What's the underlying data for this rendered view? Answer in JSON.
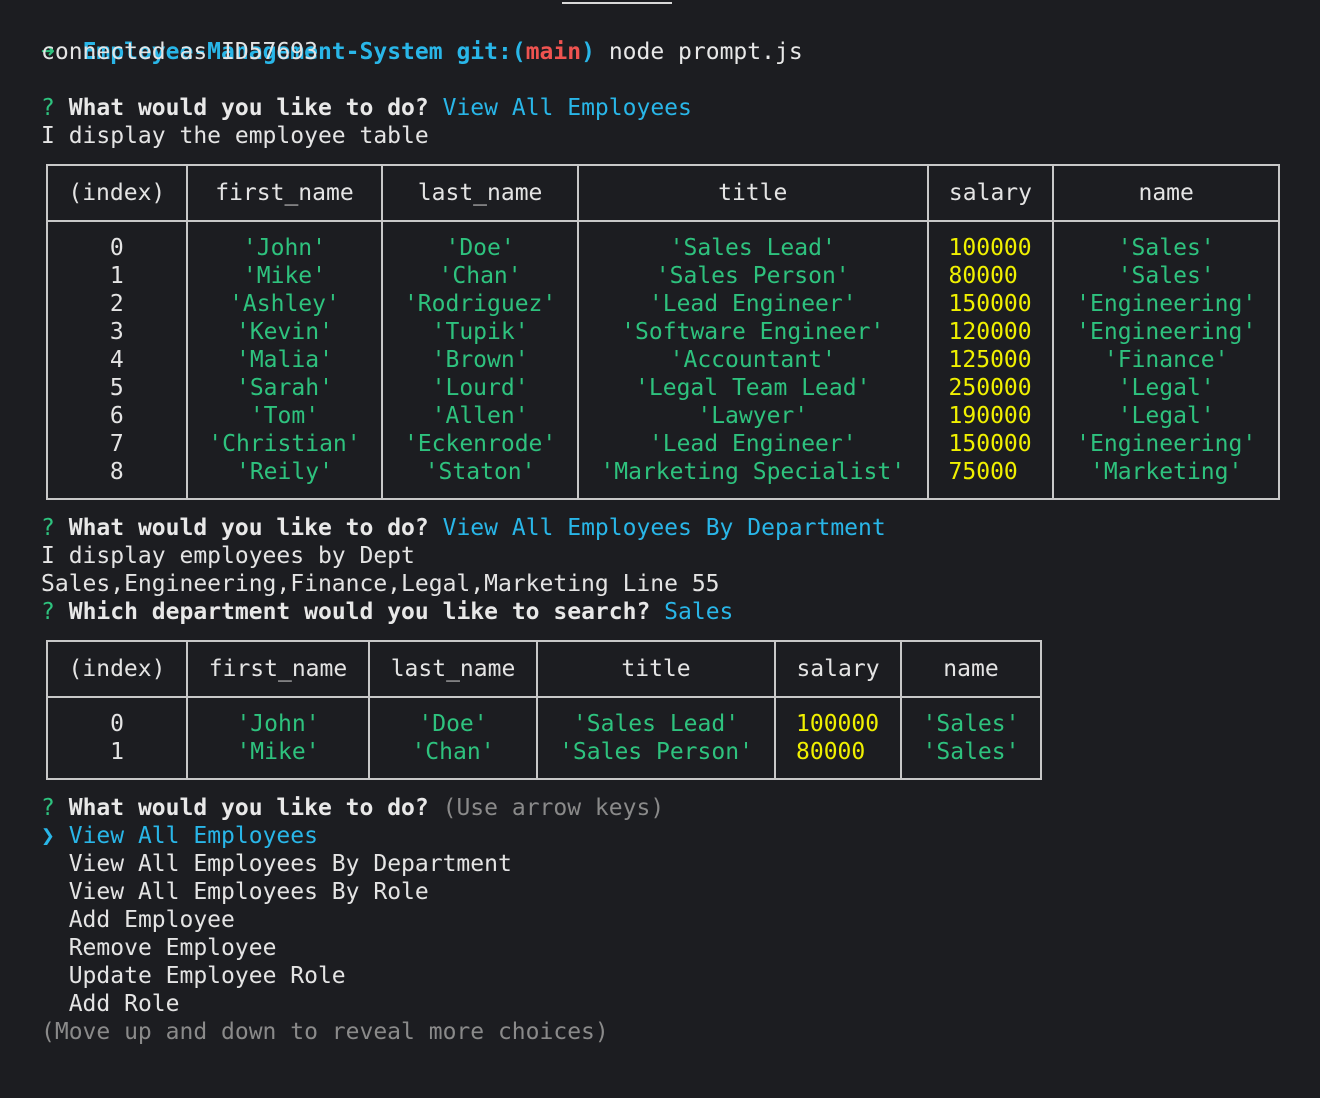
{
  "prompt_line": {
    "arrow": "➜",
    "dir": "Employee-Management-System",
    "git_prefix": "git:(",
    "branch": "main",
    "git_suffix": ")",
    "command": "node prompt.js"
  },
  "connected": "connected as ID57693",
  "q1": {
    "mark": "?",
    "question": "What would you like to do?",
    "answer": "View All Employees"
  },
  "msg1": "I display the employee table",
  "table1": {
    "headers": [
      "(index)",
      "first_name",
      "last_name",
      "title",
      "salary",
      "name"
    ],
    "rows": [
      [
        "0",
        "'John'",
        "'Doe'",
        "'Sales Lead'",
        "100000",
        "'Sales'"
      ],
      [
        "1",
        "'Mike'",
        "'Chan'",
        "'Sales Person'",
        "80000",
        "'Sales'"
      ],
      [
        "2",
        "'Ashley'",
        "'Rodriguez'",
        "'Lead Engineer'",
        "150000",
        "'Engineering'"
      ],
      [
        "3",
        "'Kevin'",
        "'Tupik'",
        "'Software Engineer'",
        "120000",
        "'Engineering'"
      ],
      [
        "4",
        "'Malia'",
        "'Brown'",
        "'Accountant'",
        "125000",
        "'Finance'"
      ],
      [
        "5",
        "'Sarah'",
        "'Lourd'",
        "'Legal Team Lead'",
        "250000",
        "'Legal'"
      ],
      [
        "6",
        "'Tom'",
        "'Allen'",
        "'Lawyer'",
        "190000",
        "'Legal'"
      ],
      [
        "7",
        "'Christian'",
        "'Eckenrode'",
        "'Lead Engineer'",
        "150000",
        "'Engineering'"
      ],
      [
        "8",
        "'Reily'",
        "'Staton'",
        "'Marketing Specialist'",
        "75000",
        "'Marketing'"
      ]
    ]
  },
  "q2": {
    "mark": "?",
    "question": "What would you like to do?",
    "answer": "View All Employees By Department"
  },
  "msg2": "I display employees by Dept",
  "msg3": "Sales,Engineering,Finance,Legal,Marketing Line 55",
  "q3": {
    "mark": "?",
    "question": "Which department would you like to search?",
    "answer": "Sales"
  },
  "table2": {
    "headers": [
      "(index)",
      "first_name",
      "last_name",
      "title",
      "salary",
      "name"
    ],
    "rows": [
      [
        "0",
        "'John'",
        "'Doe'",
        "'Sales Lead'",
        "100000",
        "'Sales'"
      ],
      [
        "1",
        "'Mike'",
        "'Chan'",
        "'Sales Person'",
        "80000",
        "'Sales'"
      ]
    ]
  },
  "q4": {
    "mark": "?",
    "question": "What would you like to do?",
    "hint": "(Use arrow keys)"
  },
  "menu": {
    "pointer": "❯",
    "items": [
      "View All Employees",
      "View All Employees By Department",
      "View All Employees By Role",
      "Add Employee",
      "Remove Employee",
      "Update Employee Role",
      "Add Role"
    ],
    "selected_index": 0,
    "footer": "(Move up and down to reveal more choices)"
  },
  "colors": {
    "background": "#1c1d21",
    "green": "#2ec27e",
    "cyan": "#29b6e8",
    "red": "#ef5350",
    "yellow": "#f0f000"
  }
}
